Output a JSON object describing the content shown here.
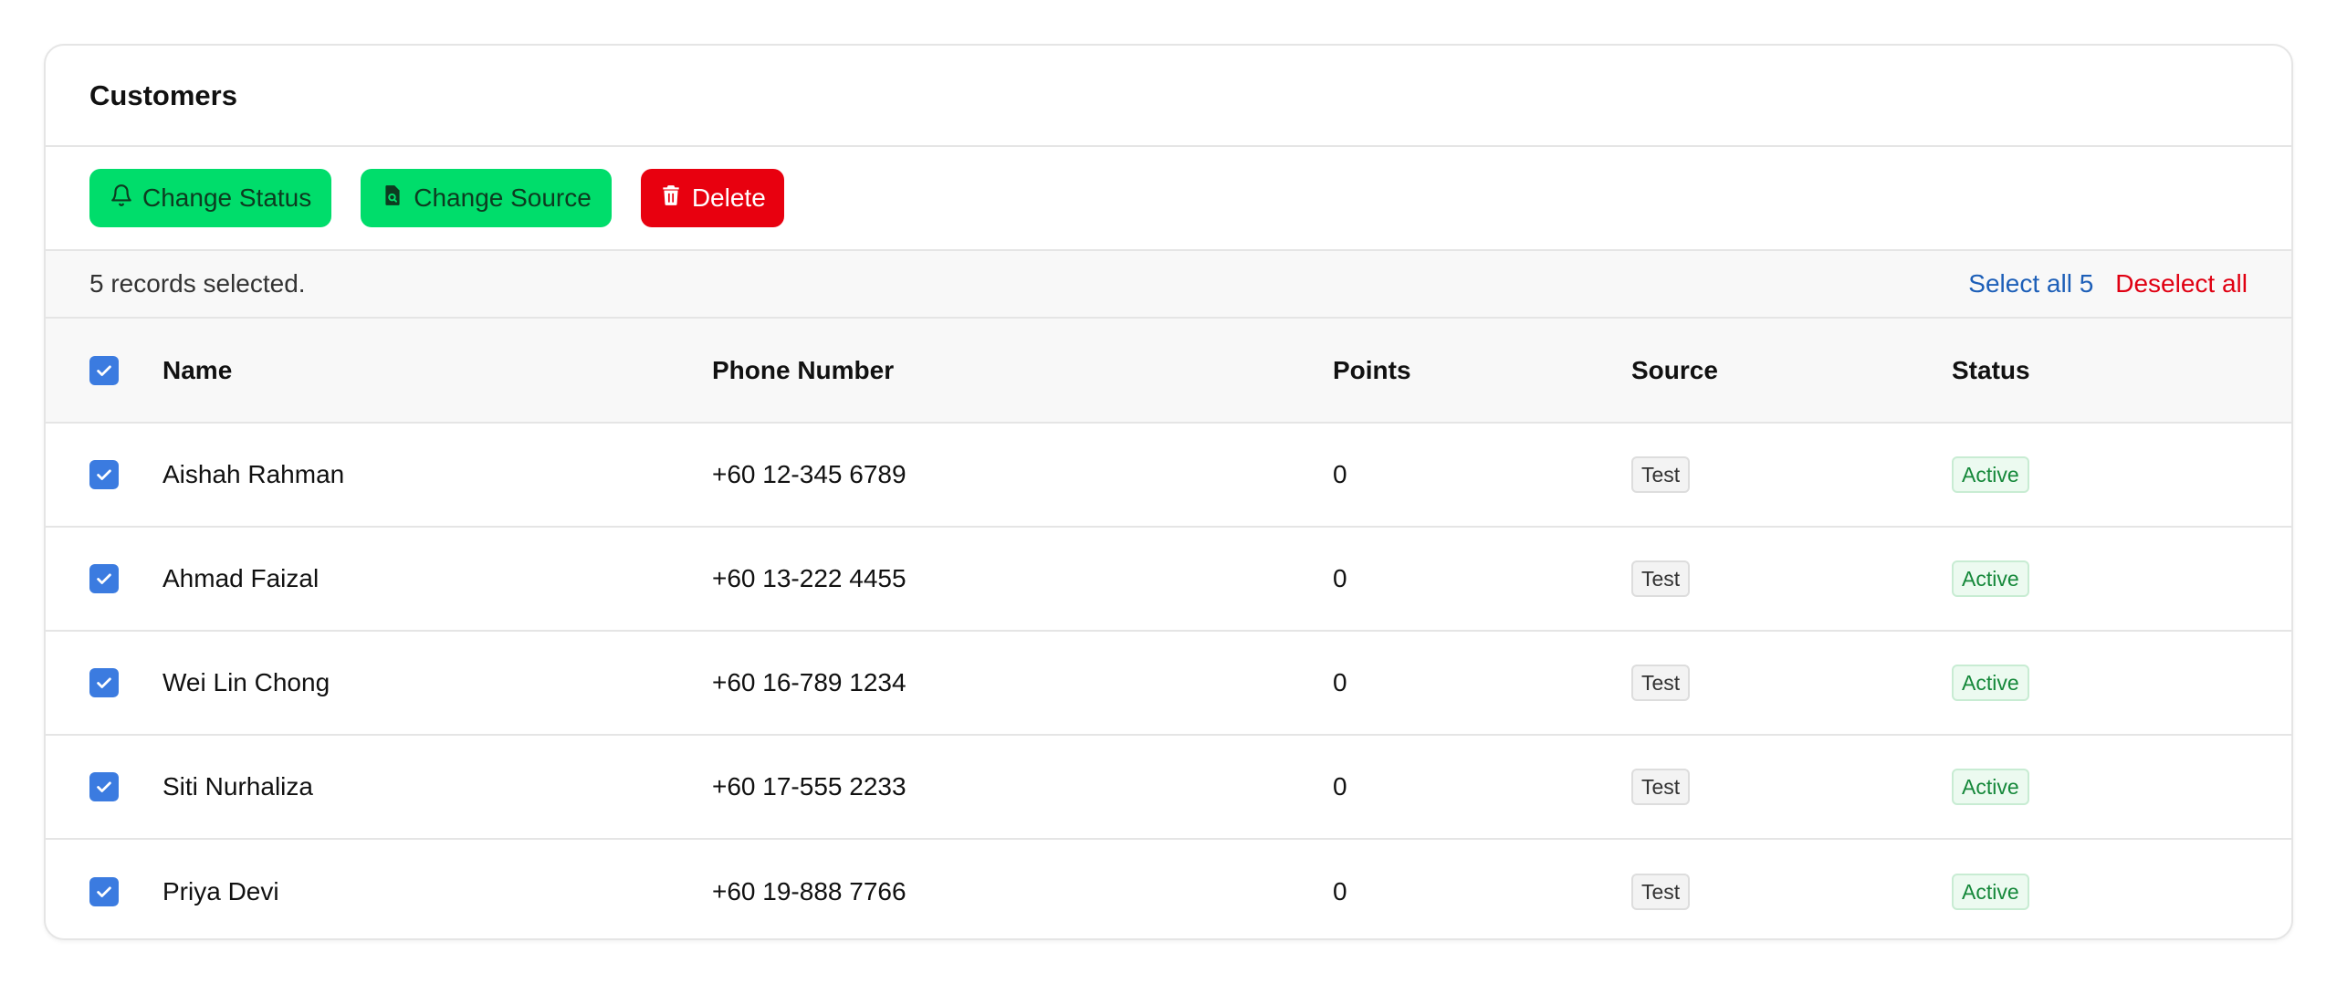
{
  "card": {
    "title": "Customers"
  },
  "toolbar": {
    "change_status_label": "Change Status",
    "change_source_label": "Change Source",
    "delete_label": "Delete"
  },
  "selection": {
    "text": "5 records selected.",
    "select_all_label": "Select all 5",
    "deselect_all_label": "Deselect all"
  },
  "table": {
    "columns": [
      "Name",
      "Phone Number",
      "Points",
      "Source",
      "Status"
    ],
    "rows": [
      {
        "name": "Aishah Rahman",
        "phone": "+60 12-345 6789",
        "points": "0",
        "source": "Test",
        "status": "Active",
        "checked": true
      },
      {
        "name": "Ahmad Faizal",
        "phone": "+60 13-222 4455",
        "points": "0",
        "source": "Test",
        "status": "Active",
        "checked": true
      },
      {
        "name": "Wei Lin Chong",
        "phone": "+60 16-789 1234",
        "points": "0",
        "source": "Test",
        "status": "Active",
        "checked": true
      },
      {
        "name": "Siti Nurhaliza",
        "phone": "+60 17-555 2233",
        "points": "0",
        "source": "Test",
        "status": "Active",
        "checked": true
      },
      {
        "name": "Priya Devi",
        "phone": "+60 19-888 7766",
        "points": "0",
        "source": "Test",
        "status": "Active",
        "checked": true
      }
    ]
  },
  "icons": {
    "change_status": "bell-icon",
    "change_source": "document-search-icon",
    "delete": "trash-icon",
    "checkbox": "check-icon"
  },
  "colors": {
    "accent_green": "#00dd6b",
    "danger_red": "#e8000f",
    "checkbox_blue": "#3b7be0",
    "link_blue": "#1d5fb8",
    "status_green": "#15883a"
  }
}
